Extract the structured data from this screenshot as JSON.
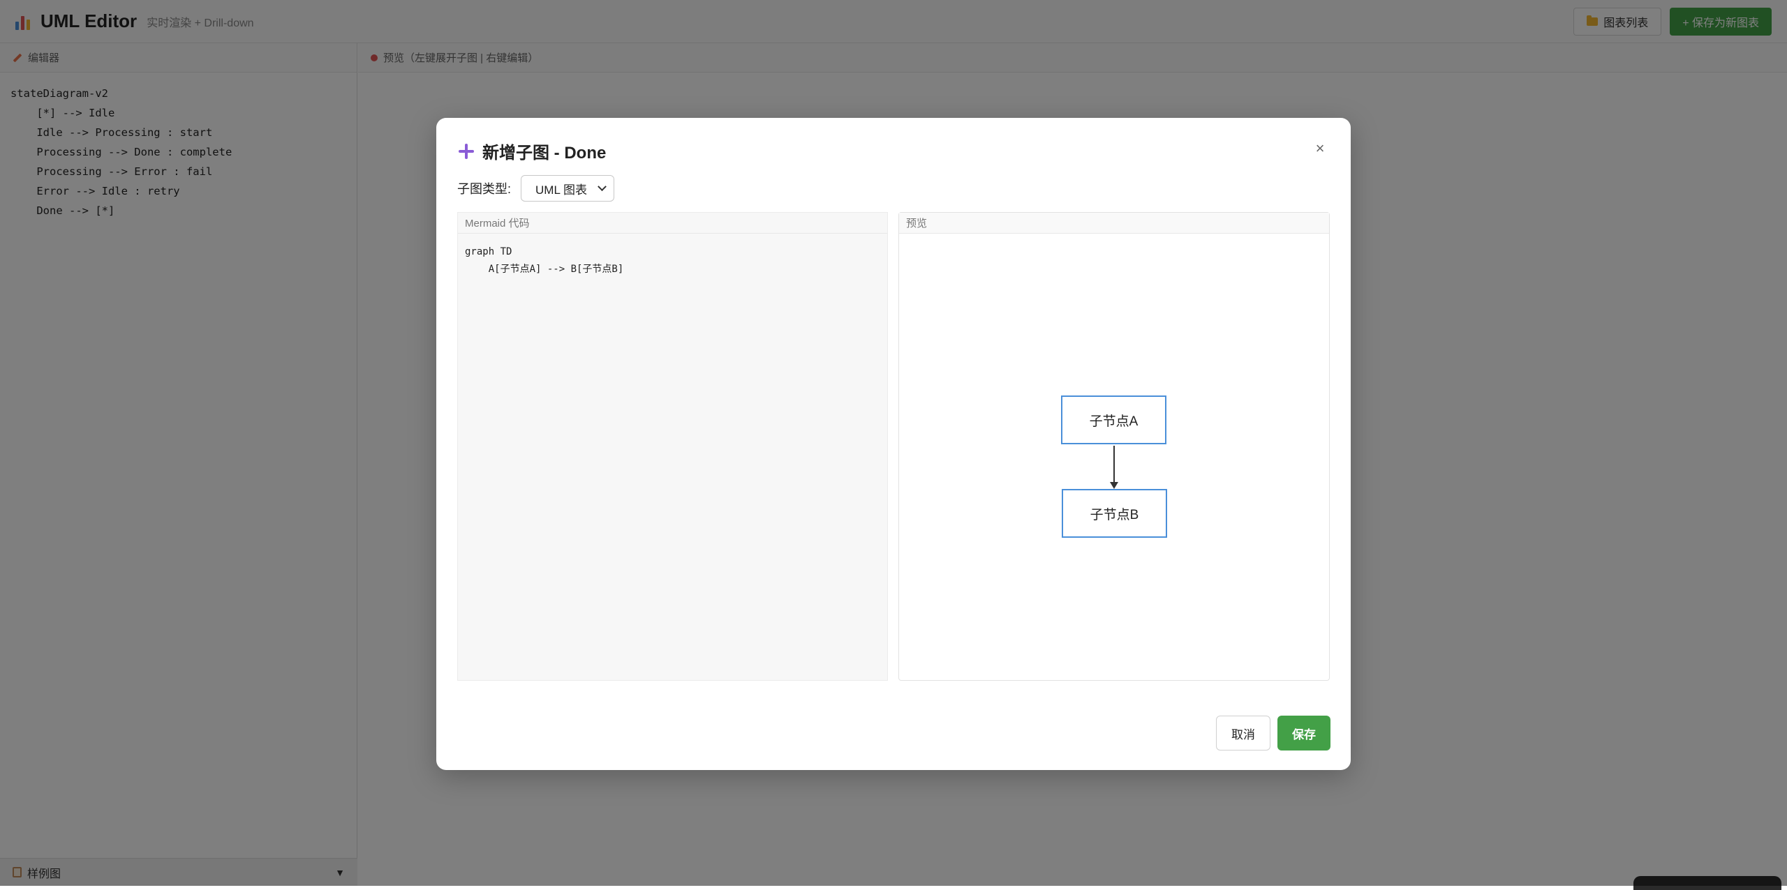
{
  "app": {
    "title": "UML Editor",
    "subtitle": "实时渲染 + Drill-down",
    "chart_list_label": "图表列表",
    "save_new_label": "+ 保存为新图表"
  },
  "editor": {
    "header": "编辑器",
    "code": "stateDiagram-v2\n    [*] --> Idle\n    Idle --> Processing : start\n    Processing --> Done : complete\n    Processing --> Error : fail\n    Error --> Idle : retry\n    Done --> [*]",
    "examples_label": "样例图",
    "examples_caret": "▼"
  },
  "preview": {
    "header": "预览（左键展开子图 | 右键编辑）"
  },
  "modal": {
    "title": "新增子图 - Done",
    "close": "×",
    "type_label": "子图类型:",
    "type_value": "UML 图表",
    "code_label": "Mermaid 代码",
    "code": "graph TD\n    A[子节点A] --> B[子节点B]",
    "preview_label": "预览",
    "node_a": "子节点A",
    "node_b": "子节点B",
    "cancel": "取消",
    "save": "保存"
  },
  "colors": {
    "accent_green": "#43a047",
    "node_border": "#4a8fd9",
    "plus_icon": "#8a5cd6"
  }
}
